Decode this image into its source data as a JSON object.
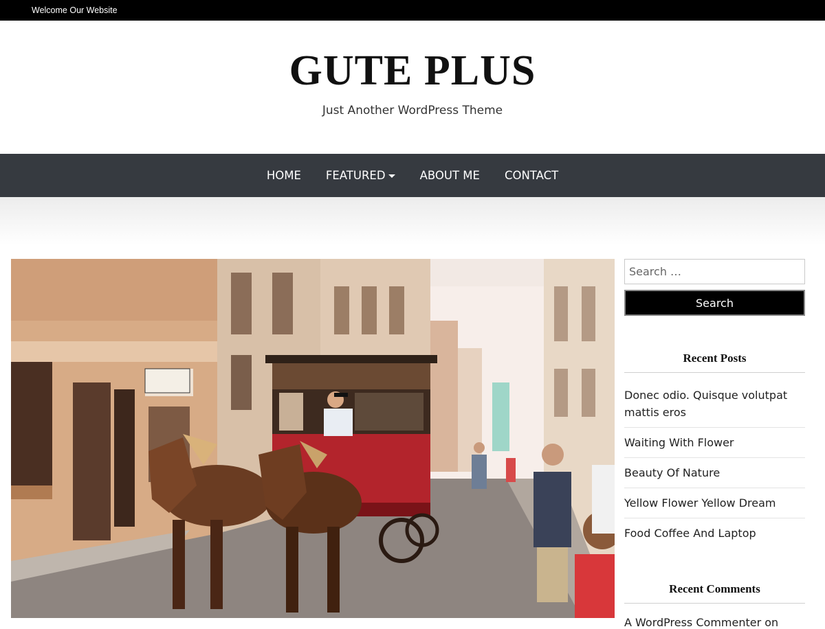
{
  "topbar": {
    "welcome": "Welcome Our Website"
  },
  "header": {
    "title": "GUTE PLUS",
    "tagline": "Just Another WordPress Theme"
  },
  "nav": {
    "items": [
      {
        "label": "HOME"
      },
      {
        "label": "FEATURED",
        "has_dropdown": true
      },
      {
        "label": "ABOUT ME"
      },
      {
        "label": "CONTACT"
      }
    ]
  },
  "colors": {
    "topbar_bg": "#000000",
    "nav_bg": "#363a40",
    "search_button_bg": "#000000"
  },
  "sidebar": {
    "search": {
      "placeholder": "Search …",
      "button_label": "Search"
    },
    "recent_posts": {
      "title": "Recent Posts",
      "items": [
        "Donec odio. Quisque volutpat mattis eros",
        "Waiting With Flower",
        "Beauty Of Nature",
        "Yellow Flower Yellow Dream",
        "Food Coffee And Laptop"
      ]
    },
    "recent_comments": {
      "title": "Recent Comments",
      "first_comment": "A WordPress Commenter on"
    }
  }
}
